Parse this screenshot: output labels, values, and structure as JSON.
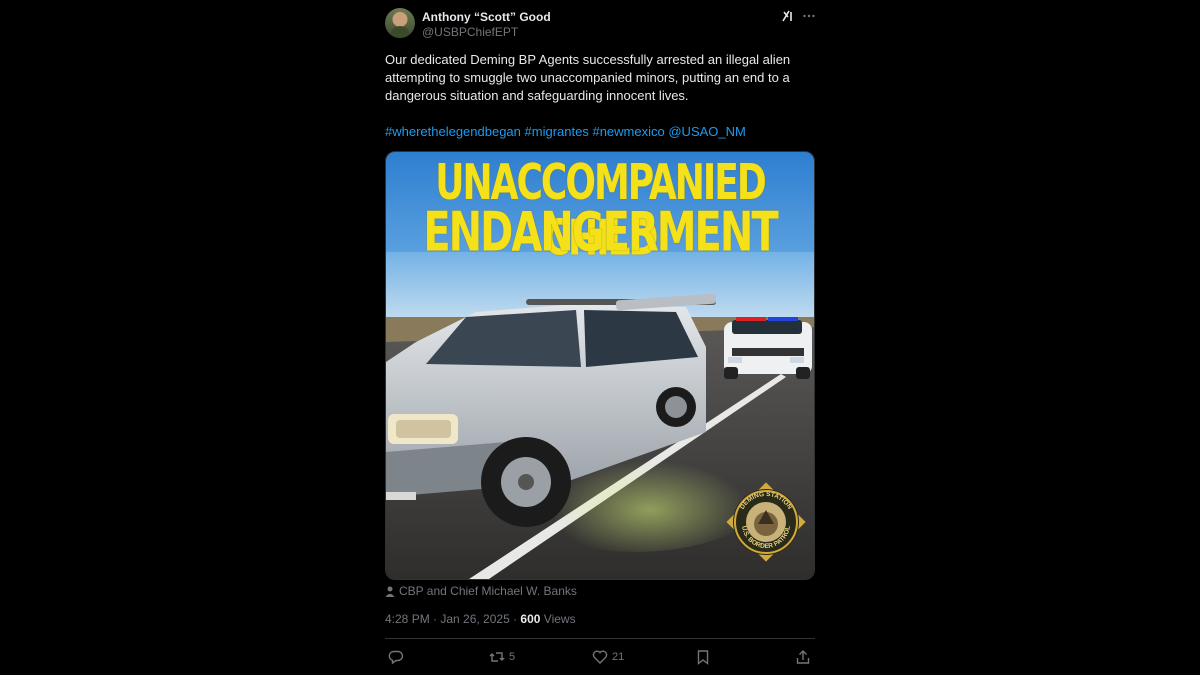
{
  "author": {
    "name": "Anthony “Scott” Good",
    "handle": "@USBPChiefEPT"
  },
  "tweet": {
    "text": "Our dedicated Deming BP Agents successfully arrested an illegal alien attempting to smuggle two unaccompanied minors, putting an end to a dangerous situation and safeguarding innocent lives.",
    "hashtags": [
      "#wherethelegendbegan",
      "#migrantes",
      "#newmexico",
      "@USAO_NM"
    ]
  },
  "media": {
    "title_line1": "UNACCOMPANIED CHILD",
    "title_line2": "ENDANGERMENT",
    "seal_top": "DEMING STATION",
    "seal_bottom": "U.S. BORDER PATROL",
    "title_color": "#f5e11a"
  },
  "attribution": "CBP and Chief Michael W. Banks",
  "meta": {
    "time_date": "4:28 PM · Jan 26, 2025 · ",
    "views_count": "600",
    "views_label": " Views"
  },
  "actions": {
    "reply_count": "",
    "retweet_count": "5",
    "like_count": "21"
  },
  "colors": {
    "background": "#000000",
    "text": "#e7e9ea",
    "secondary": "#71767b",
    "link": "#1d9bf0"
  }
}
